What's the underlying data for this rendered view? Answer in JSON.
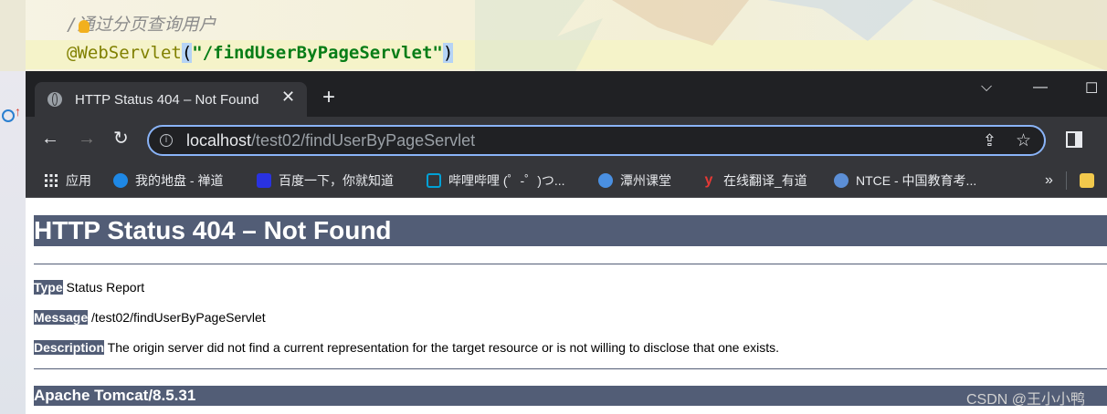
{
  "ide": {
    "top_line_partial": "                 ",
    "comment": "/通过分页查询用户",
    "annotation_name": "@WebServlet",
    "annotation_open": "(",
    "annotation_value": "\"/findUserByPageServlet\"",
    "annotation_close": ")"
  },
  "browser": {
    "tab": {
      "title": "HTTP Status 404 – Not Found",
      "close_glyph": "✕",
      "icon": "globe-icon"
    },
    "new_tab_glyph": "+",
    "window_controls": {
      "minimize": "—",
      "maximize": "☐",
      "chevron": "⌵"
    },
    "toolbar": {
      "back": "←",
      "forward": "→",
      "reload": "↻"
    },
    "address": {
      "host": "localhost",
      "path": "/test02/findUserByPageServlet"
    },
    "bookmarks": [
      {
        "label": "应用",
        "icon": "apps-grid-icon",
        "color": "#e8eaed"
      },
      {
        "label": "我的地盘 - 禅道",
        "icon": "zentao-icon",
        "color": "#1e88e5"
      },
      {
        "label": "百度一下，你就知道",
        "icon": "baidu-paw-icon",
        "color": "#2932e1"
      },
      {
        "label": "哔哩哔哩 (゜-゜)つ...",
        "icon": "bilibili-icon",
        "color": "#00a1d6"
      },
      {
        "label": "潭州课堂",
        "icon": "gear-logo-icon",
        "color": "#4a90e2"
      },
      {
        "label": "在线翻译_有道",
        "icon": "youdao-icon",
        "color": "#e53935"
      },
      {
        "label": "NTCE - 中国教育考...",
        "icon": "ntce-icon",
        "color": "#5c8fd6"
      }
    ],
    "bookmarks_overflow": "»"
  },
  "page": {
    "heading": "HTTP Status 404 – Not Found",
    "type_label": "Type",
    "type_value": " Status Report",
    "message_label": "Message",
    "message_value": " /test02/findUserByPageServlet",
    "description_label": "Description",
    "description_value": " The origin server did not find a current representation for the target resource or is not willing to disclose that one exists.",
    "footer": "Apache Tomcat/8.5.31"
  },
  "watermark": "CSDN @王小小鸭",
  "colors": {
    "tomcat_header": "#525d76",
    "chrome_dark": "#202124",
    "chrome_toolbar": "#35363a",
    "focus_ring": "#8ab4f8"
  }
}
